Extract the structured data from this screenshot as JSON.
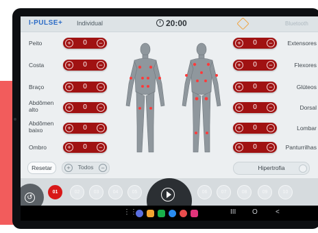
{
  "header": {
    "logo": "I-PULSE+",
    "mode": "Individual",
    "timer": "20:00",
    "bluetooth": "Bluetooth"
  },
  "left_channels": [
    {
      "label": "Peito",
      "value": "0"
    },
    {
      "label": "Costa",
      "value": "0"
    },
    {
      "label": "Braço",
      "value": "0"
    },
    {
      "label": "Abdômen alto",
      "value": "0"
    },
    {
      "label": "Abdômen baixo",
      "value": "0"
    },
    {
      "label": "Ombro",
      "value": "0"
    }
  ],
  "right_channels": [
    {
      "label": "Extensores",
      "value": "0"
    },
    {
      "label": "Flexores",
      "value": "0"
    },
    {
      "label": "Glúteos",
      "value": "0"
    },
    {
      "label": "Dorsal",
      "value": "0"
    },
    {
      "label": "Lombar",
      "value": "0"
    },
    {
      "label": "Panturrilhas",
      "value": "0"
    }
  ],
  "controls": {
    "reset": "Resetar",
    "todos": "Todos",
    "program": "Hipertrofia"
  },
  "programs": [
    "01",
    "02",
    "03",
    "04",
    "05",
    "06",
    "07",
    "08",
    "09",
    "10"
  ],
  "colors": {
    "accent": "#f25c5c",
    "pill": "#a01212",
    "active_program": "#d81818",
    "logo": "#2c6cc6"
  },
  "icons": {
    "plus": "+",
    "minus": "−",
    "back": "↺",
    "nav_recent": "III",
    "nav_home": "O",
    "nav_back": "<"
  }
}
